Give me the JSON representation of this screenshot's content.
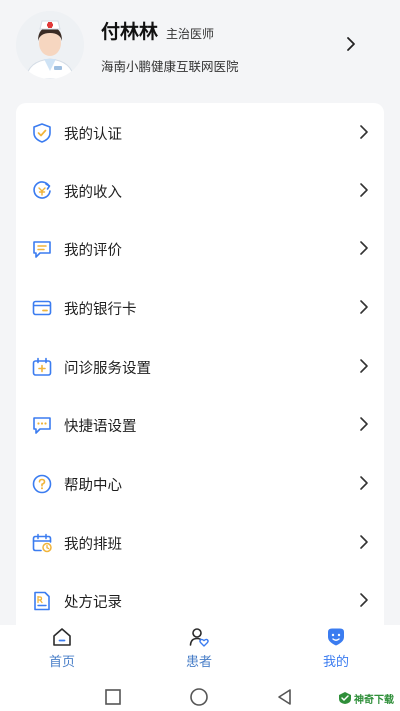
{
  "profile": {
    "name": "付林林",
    "title": "主治医师",
    "hospital": "海南小鹏健康互联网医院"
  },
  "menu": {
    "items": [
      {
        "label": "我的认证",
        "icon": "shield-check-icon"
      },
      {
        "label": "我的收入",
        "icon": "income-icon"
      },
      {
        "label": "我的评价",
        "icon": "comment-icon"
      },
      {
        "label": "我的银行卡",
        "icon": "bank-card-icon"
      },
      {
        "label": "问诊服务设置",
        "icon": "calendar-plus-icon"
      },
      {
        "label": "快捷语设置",
        "icon": "chat-dots-icon"
      },
      {
        "label": "帮助中心",
        "icon": "help-icon"
      },
      {
        "label": "我的排班",
        "icon": "schedule-icon"
      },
      {
        "label": "处方记录",
        "icon": "prescription-icon"
      }
    ]
  },
  "tabbar": {
    "tabs": [
      {
        "label": "首页",
        "icon": "home-icon"
      },
      {
        "label": "患者",
        "icon": "patient-icon"
      },
      {
        "label": "我的",
        "icon": "profile-icon",
        "active": true
      }
    ]
  },
  "watermark": {
    "text": "神奇下载"
  },
  "colors": {
    "accent": "#3b7cf0",
    "icon_yellow": "#f0b43a",
    "active_tab": "#3b7cf0",
    "inactive_tab": "#4a7fc8"
  }
}
